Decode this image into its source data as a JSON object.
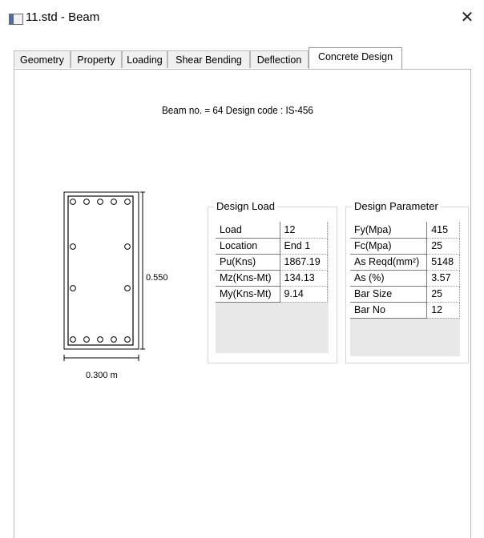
{
  "window": {
    "title": "11.std - Beam",
    "close_glyph": "✕"
  },
  "tabs": [
    {
      "label": "Geometry",
      "selected": false
    },
    {
      "label": "Property",
      "selected": false
    },
    {
      "label": "Loading",
      "selected": false
    },
    {
      "label": "Shear Bending",
      "selected": false
    },
    {
      "label": "Deflection",
      "selected": false
    },
    {
      "label": "Concrete Design",
      "selected": true
    }
  ],
  "header": {
    "text": "Beam no. = 64  Design code :  IS-456"
  },
  "section": {
    "depth_label": "0.550",
    "width_label": "0.300 m"
  },
  "design_load": {
    "title": "Design Load",
    "rows": [
      {
        "label": "Load",
        "value": "12"
      },
      {
        "label": "Location",
        "value": "End 1"
      },
      {
        "label": "Pu(Kns)",
        "value": "1867.19"
      },
      {
        "label": "Mz(Kns-Mt)",
        "value": "134.13"
      },
      {
        "label": "My(Kns-Mt)",
        "value": "9.14"
      }
    ]
  },
  "design_parameter": {
    "title": "Design Parameter",
    "rows": [
      {
        "label": "Fy(Mpa)",
        "value": "415"
      },
      {
        "label": "Fc(Mpa)",
        "value": "25"
      },
      {
        "label": "As Reqd(mm²)",
        "value": "5148"
      },
      {
        "label": "As (%)",
        "value": "3.57"
      },
      {
        "label": "Bar Size",
        "value": "25"
      },
      {
        "label": "Bar No",
        "value": "12"
      }
    ]
  },
  "icons": {
    "app": "beam-window-icon",
    "close": "close-icon"
  }
}
